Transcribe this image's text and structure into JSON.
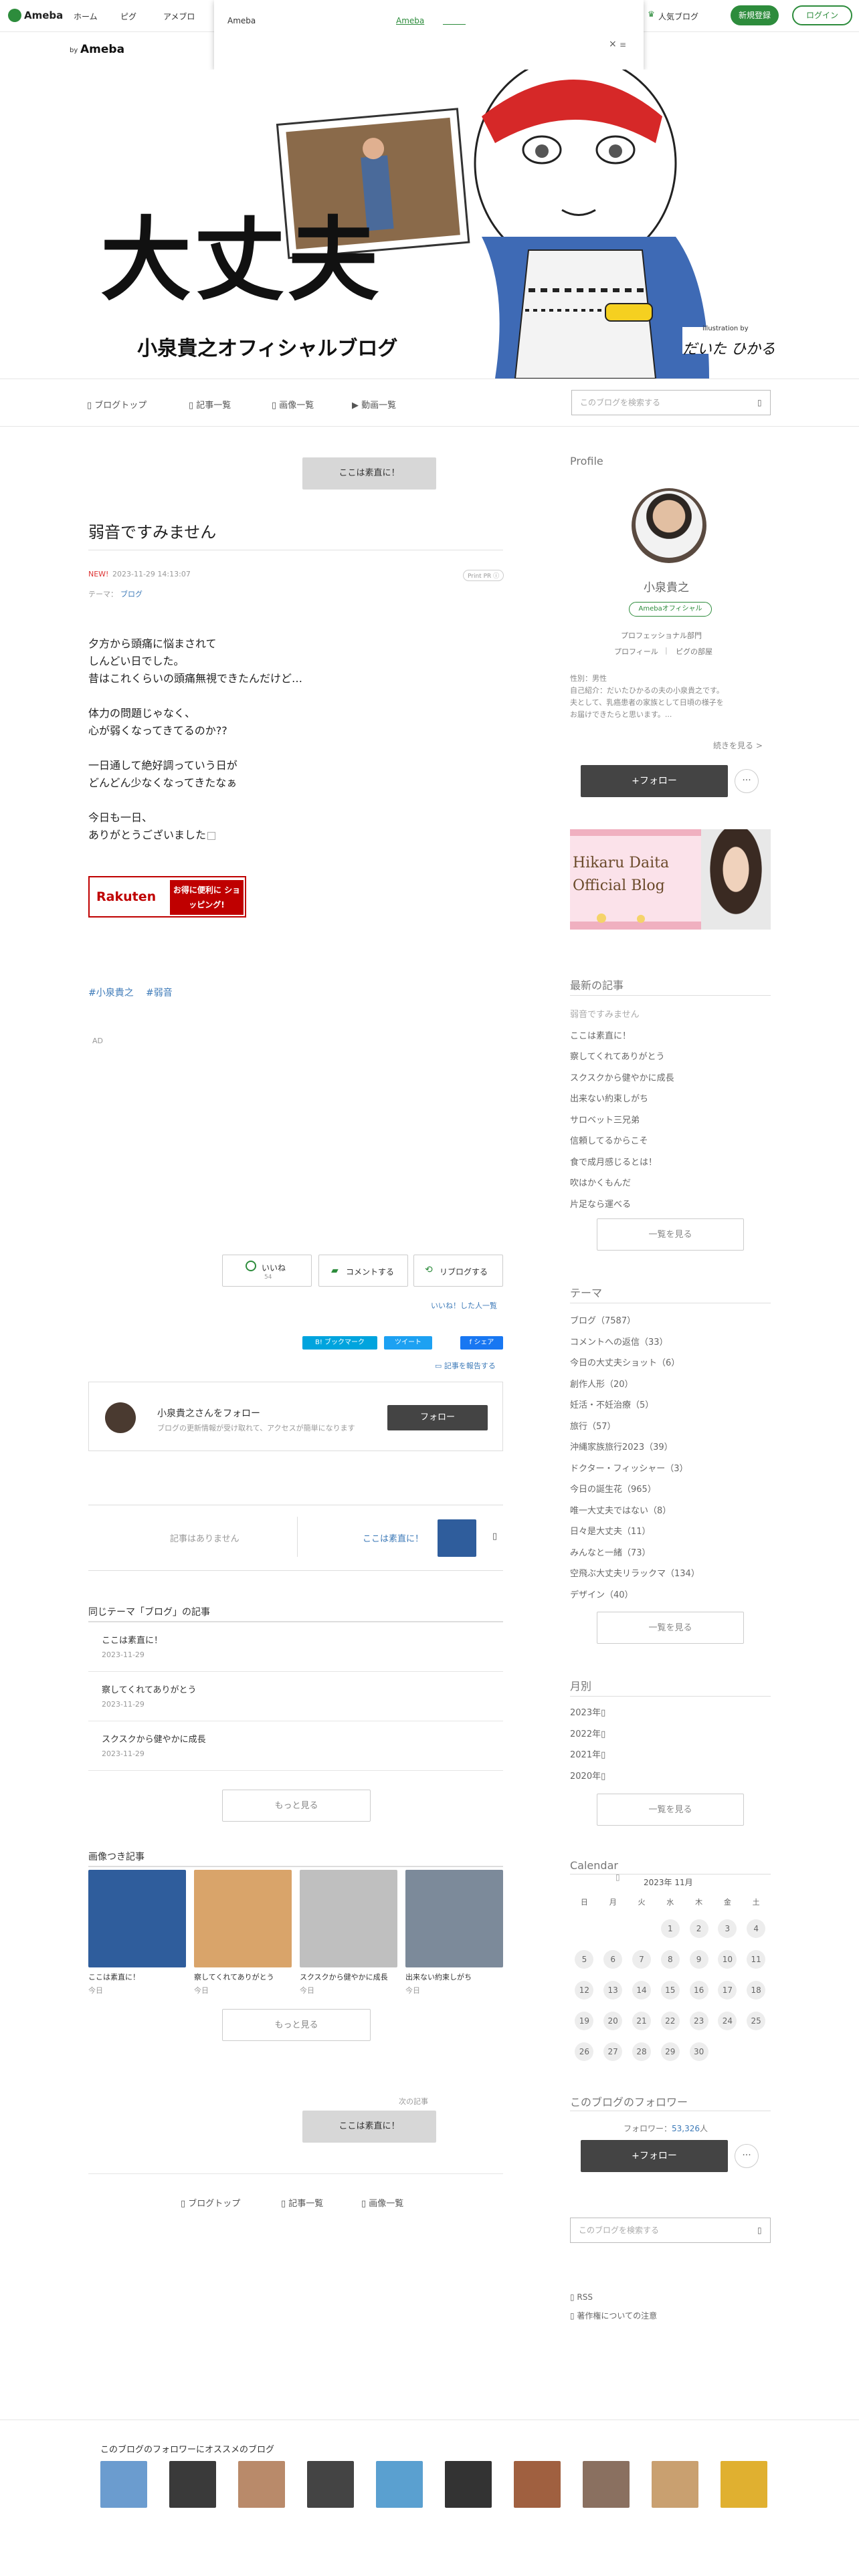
{
  "topbar": {
    "logo": "Ameba",
    "links": [
      "ホーム",
      "ピグ",
      "アメブロ"
    ],
    "popular_blog": "人気ブログ",
    "signup": "新規登録",
    "login": "ログイン"
  },
  "popup": {
    "title": "Ameba",
    "link": "Ameba",
    "close": "×"
  },
  "brand": {
    "by": "by",
    "name": "Ameba"
  },
  "hero": {
    "title": "大丈夫",
    "subtitle": "小泉貴之オフィシャルブログ",
    "credit_small": "illustration by",
    "credit_name": "だいた ひかる"
  },
  "nav": {
    "items": [
      "ブログトップ",
      "記事一覧",
      "画像一覧",
      "動画一覧"
    ],
    "search_placeholder": "このブログを検索する"
  },
  "article": {
    "top_button": "ここは素直に！",
    "title": "弱音ですみません",
    "new_badge": "NEW!",
    "datetime": "2023-11-29 14:13:07",
    "theme_label": "テーマ：",
    "theme": "ブログ",
    "pr": "Print PR ⓘ",
    "paragraphs": [
      [
        "夕方から頭痛に悩まされて",
        "しんどい日でした。",
        "昔はこれくらいの頭痛無視できたんだけど…"
      ],
      [
        "体力の問題じゃなく、",
        "心が弱くなってきてるのか??"
      ],
      [
        "一日通して絶好調っていう日が",
        "どんどん少なくなってきたなぁ"
      ],
      [
        "今日も一日、",
        "ありがとうございました"
      ]
    ],
    "banner_brand": "Rakuten",
    "banner_text": "お得に便利に ショッピング!",
    "hashtags": [
      "#小泉貴之",
      "#弱音"
    ],
    "ad": "AD",
    "like": "いいね",
    "like_count": "54",
    "comment": "コメントする",
    "reblog": "リブログする",
    "liked_by": "いいね！した人一覧",
    "hatena": "B! ブックマーク",
    "tweet": "ツイート",
    "share": "シェア",
    "report": "記事を報告する",
    "follow_title": "小泉貴之さんをフォロー",
    "follow_desc": "ブログの更新情報が受け取れて、アクセスが簡単になります",
    "follow_button": "フォロー",
    "prev_none": "記事はありません",
    "next_title": "ここは素直に！",
    "same_theme_head": "同じテーマ「ブログ」の記事",
    "same_theme": [
      {
        "title": "ここは素直に！",
        "date": "2023-11-29"
      },
      {
        "title": "察してくれてありがとう",
        "date": "2023-11-29"
      },
      {
        "title": "スクスクから健やかに成長",
        "date": "2023-11-29"
      }
    ],
    "more": "もっと見る",
    "image_head": "画像つき記事",
    "images": [
      {
        "title": "ここは素直に！",
        "date": "今日",
        "color": "#2f5d9c"
      },
      {
        "title": "察してくれてありがとう",
        "date": "今日",
        "color": "#d9a46a"
      },
      {
        "title": "スクスクから健やかに成長",
        "date": "今日",
        "color": "#bfbfbf"
      },
      {
        "title": "出来ない約束しがち",
        "date": "今日",
        "color": "#7c8a9a"
      }
    ],
    "next_label": "次の記事",
    "next_button": "ここは素直に！",
    "bottom_nav": [
      "ブログトップ",
      "記事一覧",
      "画像一覧"
    ]
  },
  "sidebar": {
    "profile_head": "Profile",
    "name": "小泉貴之",
    "badge": "Amebaオフィシャル",
    "category": "プロフェッショナル部門",
    "profile_label": "プロフィール",
    "pigg_label": "ピグの部屋",
    "gender": "性別：男性",
    "intro": "自己紹介：だいたひかるの夫の小泉貴之です。",
    "intro2": "夫として、乳癌患者の家族として日頃の様子を",
    "intro3": "お届けできたらと思います。...",
    "continue": "続きを見る >",
    "follow": "+フォロー",
    "banner_title": "Hikaru Daita",
    "banner_sub": "Official Blog",
    "latest_head": "最新の記事",
    "latest": [
      "弱音ですみません",
      "ここは素直に！",
      "察してくれてありがとう",
      "スクスクから健やかに成長",
      "出来ない約束しがち",
      "サロベット三兄弟",
      "信頼してるからこそ",
      "食で成月感じるとは！",
      "吹はかくもんだ",
      "片足なら運べる"
    ],
    "list_all": "一覧を見る",
    "theme_head": "テーマ",
    "themes": [
      "ブログ（7587）",
      "コメントへの返信（33）",
      "今日の大丈夫ショット（6）",
      "創作人形（20）",
      "妊活・不妊治療（5）",
      "旅行（57）",
      "沖縄家族旅行2023（39）",
      "ドクター・フィッシャー（3）",
      "今日の誕生花（965）",
      "唯一大丈夫ではない（8）",
      "日々是大丈夫（11）",
      "みんなと一緒（73）",
      "空飛ぶ大丈夫リラックマ（134）",
      "デザイン（40）"
    ],
    "month_head": "月別",
    "months": [
      "2023年",
      "2022年",
      "2021年",
      "2020年"
    ],
    "calendar_head": "Calendar",
    "calendar_title": "2023年 11月",
    "weekdays": [
      "日",
      "月",
      "火",
      "水",
      "木",
      "金",
      "土"
    ],
    "days": [
      "",
      "",
      "",
      "1",
      "2",
      "3",
      "4",
      "5",
      "6",
      "7",
      "8",
      "9",
      "10",
      "11",
      "12",
      "13",
      "14",
      "15",
      "16",
      "17",
      "18",
      "19",
      "20",
      "21",
      "22",
      "23",
      "24",
      "25",
      "26",
      "27",
      "28",
      "29",
      "30",
      "",
      ""
    ],
    "followers_head": "このブログのフォロワー",
    "followers_label": "フォロワー：",
    "followers_count": "53,326",
    "followers_unit": "人",
    "search_placeholder": "このブログを検索する",
    "rss": "RSS",
    "copyright": "著作権についての注意"
  },
  "recommend": {
    "head": "このブログのフォロワーにオススメのブログ",
    "colors": [
      "#6b9ccf",
      "#3a3a3a",
      "#b98a6a",
      "#444",
      "#5aa0d0",
      "#333",
      "#a06040",
      "#8a7060",
      "#c9a070",
      "#e0b030"
    ]
  }
}
